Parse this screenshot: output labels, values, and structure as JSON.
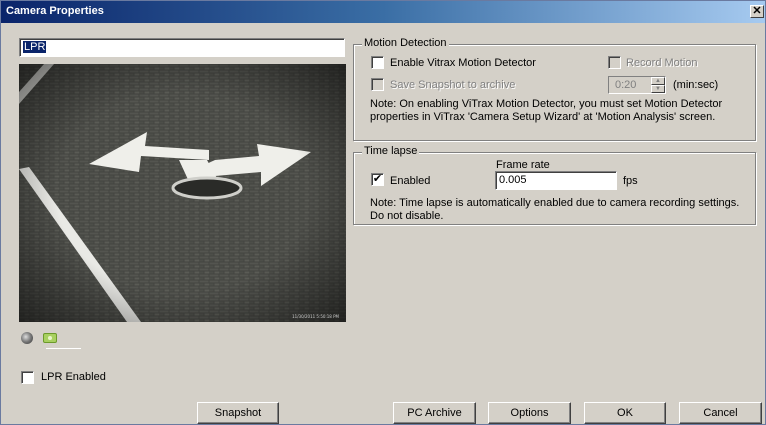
{
  "window": {
    "title": "Camera Properties",
    "close_glyph": "✕"
  },
  "camera_name": "LPR",
  "preview": {
    "timestamp": "11/30/2011 5:50:18 PM"
  },
  "lpr": {
    "label": "LPR Enabled",
    "checked": false
  },
  "motion_detection": {
    "legend": "Motion Detection",
    "enable_label": "Enable Vitrax Motion Detector",
    "record_label": "Record Motion",
    "snapshot_label": "Save Snapshot to archive",
    "interval_value": "0:20",
    "interval_unit": "(min:sec)",
    "note": "Note: On enabling ViTrax Motion Detector, you must set Motion Detector properties in ViTrax 'Camera Setup Wizard' at 'Motion Analysis' screen."
  },
  "time_lapse": {
    "legend": "Time lapse",
    "enabled_label": "Enabled",
    "enabled_check": "✔",
    "frame_rate_label": "Frame rate",
    "frame_rate_value": "0.005",
    "unit": "fps",
    "note": "Note: Time lapse is automatically enabled due to camera recording settings. Do not disable."
  },
  "buttons": {
    "snapshot": "Snapshot",
    "pc_archive": "PC Archive",
    "options": "Options",
    "ok": "OK",
    "cancel": "Cancel"
  },
  "icons": [
    "close-icon",
    "record-icon",
    "camera-icon"
  ]
}
